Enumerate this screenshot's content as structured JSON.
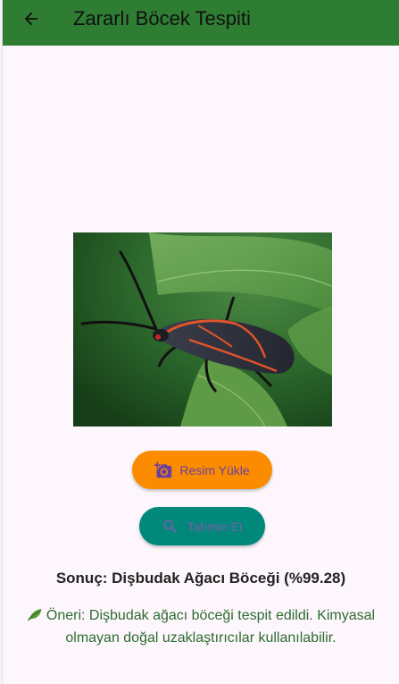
{
  "app_bar": {
    "title": "Zararlı Böcek Tespiti",
    "back_icon": "arrow-back-icon",
    "color": "#2e7d32"
  },
  "image": {
    "subject": "boxelder-bug-photo"
  },
  "buttons": {
    "upload": {
      "label": "Resim Yükle",
      "icon": "add-photo-icon",
      "color": "#fb8c00"
    },
    "predict": {
      "label": "Tahmin Et",
      "icon": "search-icon",
      "color": "#00897b"
    }
  },
  "result": {
    "text": "Sonuç: Dişbudak Ağacı Böceği (%99.28)"
  },
  "advice": {
    "icon": "leaf-icon",
    "text": "Öneri: Dişbudak ağacı böceği tespit edildi. Kimyasal olmayan doğal uzaklaştırıcılar kullanılabilir."
  },
  "colors": {
    "background": "#fdf7fd",
    "button_text": "#6a3fa3",
    "advice_text": "#2e6b2f"
  }
}
